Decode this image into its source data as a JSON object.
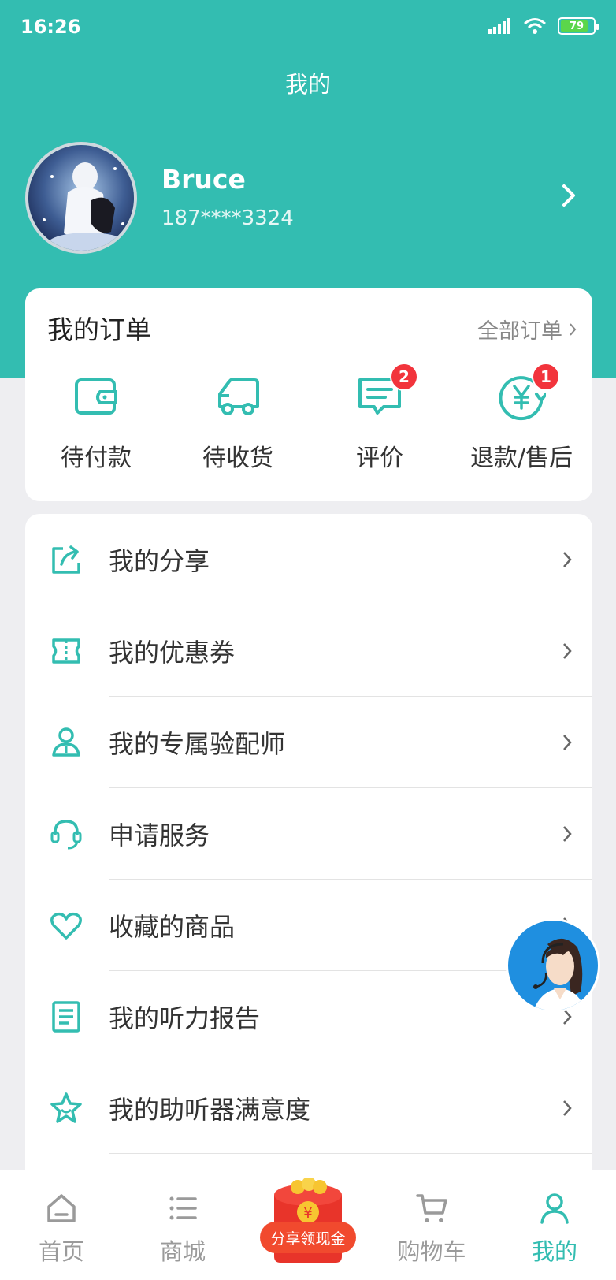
{
  "status_bar": {
    "time": "16:26",
    "battery": "79"
  },
  "header": {
    "title": "我的"
  },
  "profile": {
    "name": "Bruce",
    "phone": "187****3324"
  },
  "orders": {
    "title": "我的订单",
    "all_label": "全部订单",
    "items": [
      {
        "label": "待付款",
        "icon": "wallet-icon"
      },
      {
        "label": "待收货",
        "icon": "truck-icon"
      },
      {
        "label": "评价",
        "icon": "comment-icon",
        "badge": "2"
      },
      {
        "label": "退款/售后",
        "icon": "refund-icon",
        "badge": "1"
      }
    ]
  },
  "menu": [
    {
      "label": "我的分享",
      "icon": "share-icon"
    },
    {
      "label": "我的优惠券",
      "icon": "coupon-icon"
    },
    {
      "label": "我的专属验配师",
      "icon": "person-icon"
    },
    {
      "label": "申请服务",
      "icon": "headset-icon"
    },
    {
      "label": "收藏的商品",
      "icon": "heart-icon"
    },
    {
      "label": "我的听力报告",
      "icon": "report-icon"
    },
    {
      "label": "我的助听器满意度",
      "icon": "star-icon"
    }
  ],
  "tabs": [
    {
      "label": "首页",
      "icon": "home-icon"
    },
    {
      "label": "商城",
      "icon": "list-icon"
    },
    {
      "label": "购物车",
      "icon": "cart-icon"
    },
    {
      "label": "我的",
      "icon": "user-icon",
      "active": true
    }
  ],
  "promo": {
    "label": "分享领现金",
    "symbol": "¥"
  },
  "colors": {
    "accent": "#33bdb1",
    "badge": "#f2343c",
    "promo": "#f14a2e"
  }
}
